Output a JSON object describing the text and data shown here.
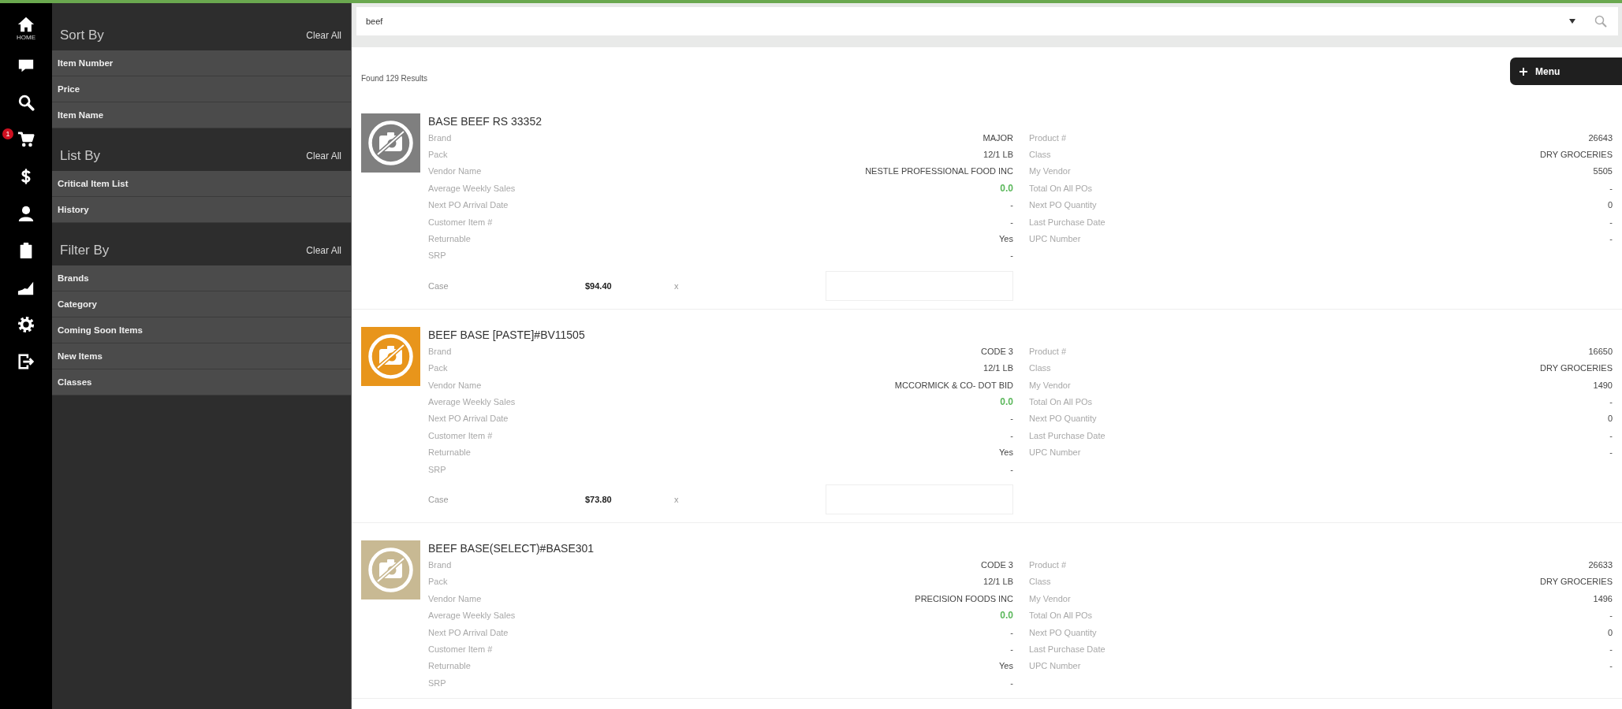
{
  "nav": {
    "home_label": "HOME",
    "cart_badge": "1"
  },
  "filters": {
    "sections": [
      {
        "title": "Sort By",
        "clear": "Clear All",
        "items": [
          "Item Number",
          "Price",
          "Item Name"
        ]
      },
      {
        "title": "List By",
        "clear": "Clear All",
        "items": [
          "Critical Item List",
          "History"
        ]
      },
      {
        "title": "Filter By",
        "clear": "Clear All",
        "items": [
          "Brands",
          "Category",
          "Coming Soon Items",
          "New Items",
          "Classes"
        ]
      }
    ]
  },
  "search": {
    "value": "beef"
  },
  "results": {
    "count_text": "Found 129 Results",
    "menu_button": "Menu"
  },
  "products": [
    {
      "title": "BASE BEEF RS 33352",
      "color": "#7f7f7f",
      "details": [
        {
          "label": "Brand",
          "value": "MAJOR"
        },
        {
          "label": "Pack",
          "value": "12/1 LB"
        },
        {
          "label": "Vendor Name",
          "value": "NESTLE PROFESSIONAL FOOD INC"
        },
        {
          "label": "Average Weekly Sales",
          "value": "0.0",
          "color": "#5cb85c"
        },
        {
          "label": "Next PO Arrival Date",
          "value": "-"
        },
        {
          "label": "Customer Item #",
          "value": "-"
        },
        {
          "label": "Returnable",
          "value": "Yes"
        },
        {
          "label": "SRP",
          "value": "-"
        }
      ],
      "case_label": "Case",
      "price": "$94.40",
      "times": "x",
      "info": [
        {
          "label": "Product #",
          "value": "26643"
        },
        {
          "label": "Class",
          "value": "DRY GROCERIES"
        },
        {
          "label": "My Vendor",
          "value": "5505"
        },
        {
          "label": "Total On All POs",
          "value": "-"
        },
        {
          "label": "Next PO Quantity",
          "value": "0"
        },
        {
          "label": "Last Purchase Date",
          "value": "-"
        },
        {
          "label": "UPC Number",
          "value": "-"
        }
      ]
    },
    {
      "title": "BEEF BASE [PASTE]#BV11505",
      "color": "#e8951b",
      "details": [
        {
          "label": "Brand",
          "value": "CODE 3"
        },
        {
          "label": "Pack",
          "value": "12/1 LB"
        },
        {
          "label": "Vendor Name",
          "value": "MCCORMICK & CO- DOT BID"
        },
        {
          "label": "Average Weekly Sales",
          "value": "0.0",
          "color": "#5cb85c"
        },
        {
          "label": "Next PO Arrival Date",
          "value": "-"
        },
        {
          "label": "Customer Item #",
          "value": "-"
        },
        {
          "label": "Returnable",
          "value": "Yes"
        },
        {
          "label": "SRP",
          "value": "-"
        }
      ],
      "case_label": "Case",
      "price": "$73.80",
      "times": "x",
      "info": [
        {
          "label": "Product #",
          "value": "16650"
        },
        {
          "label": "Class",
          "value": "DRY GROCERIES"
        },
        {
          "label": "My Vendor",
          "value": "1490"
        },
        {
          "label": "Total On All POs",
          "value": "-"
        },
        {
          "label": "Next PO Quantity",
          "value": "0"
        },
        {
          "label": "Last Purchase Date",
          "value": "-"
        },
        {
          "label": "UPC Number",
          "value": "-"
        }
      ]
    },
    {
      "title": "BEEF BASE(SELECT)#BASE301",
      "color": "#c8b993",
      "details": [
        {
          "label": "Brand",
          "value": "CODE 3"
        },
        {
          "label": "Pack",
          "value": "12/1 LB"
        },
        {
          "label": "Vendor Name",
          "value": "PRECISION FOODS INC"
        },
        {
          "label": "Average Weekly Sales",
          "value": "0.0",
          "color": "#5cb85c"
        },
        {
          "label": "Next PO Arrival Date",
          "value": "-"
        },
        {
          "label": "Customer Item #",
          "value": "-"
        },
        {
          "label": "Returnable",
          "value": "Yes"
        },
        {
          "label": "SRP",
          "value": "-"
        }
      ],
      "info": [
        {
          "label": "Product #",
          "value": "26633"
        },
        {
          "label": "Class",
          "value": "DRY GROCERIES"
        },
        {
          "label": "My Vendor",
          "value": "1496"
        },
        {
          "label": "Total On All POs",
          "value": "-"
        },
        {
          "label": "Next PO Quantity",
          "value": "0"
        },
        {
          "label": "Last Purchase Date",
          "value": "-"
        },
        {
          "label": "UPC Number",
          "value": "-"
        }
      ]
    }
  ]
}
